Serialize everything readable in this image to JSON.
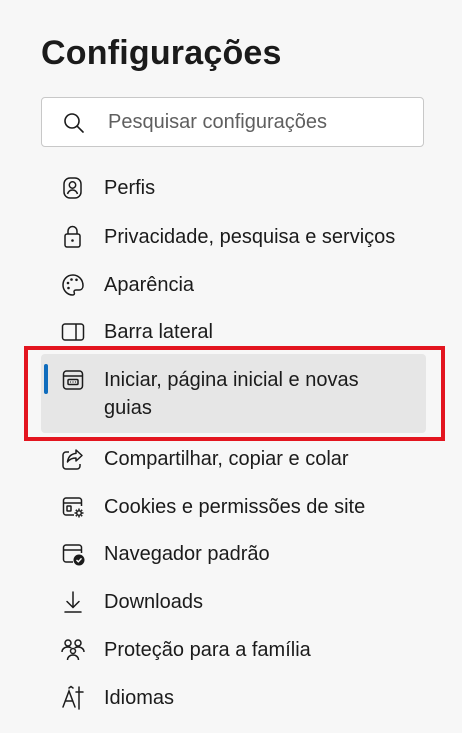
{
  "page": {
    "title": "Configurações"
  },
  "search": {
    "placeholder": "Pesquisar configurações",
    "value": ""
  },
  "nav": {
    "items": [
      {
        "id": "perfis",
        "label": "Perfis",
        "icon": "profile-icon"
      },
      {
        "id": "privacidade",
        "label": "Privacidade, pesquisa e serviços",
        "icon": "lock-icon"
      },
      {
        "id": "aparencia",
        "label": "Aparência",
        "icon": "palette-icon"
      },
      {
        "id": "barra-lateral",
        "label": "Barra lateral",
        "icon": "sidebar-icon"
      },
      {
        "id": "iniciar",
        "label": "Iniciar, página inicial e novas guias",
        "icon": "home-page-icon",
        "selected": true
      },
      {
        "id": "compartilhar",
        "label": "Compartilhar, copiar e colar",
        "icon": "share-icon"
      },
      {
        "id": "cookies",
        "label": "Cookies e permissões de site",
        "icon": "site-permissions-icon"
      },
      {
        "id": "navegador",
        "label": "Navegador padrão",
        "icon": "default-browser-icon"
      },
      {
        "id": "downloads",
        "label": "Downloads",
        "icon": "download-icon"
      },
      {
        "id": "familia",
        "label": "Proteção para a família",
        "icon": "family-icon"
      },
      {
        "id": "idiomas",
        "label": "Idiomas",
        "icon": "languages-icon"
      }
    ]
  },
  "colors": {
    "panel_background": "#f7f7f7",
    "selected_background": "#e6e6e6",
    "accent": "#0f6cbd",
    "highlight_border": "#e3151f",
    "text": "#1b1b1b"
  }
}
